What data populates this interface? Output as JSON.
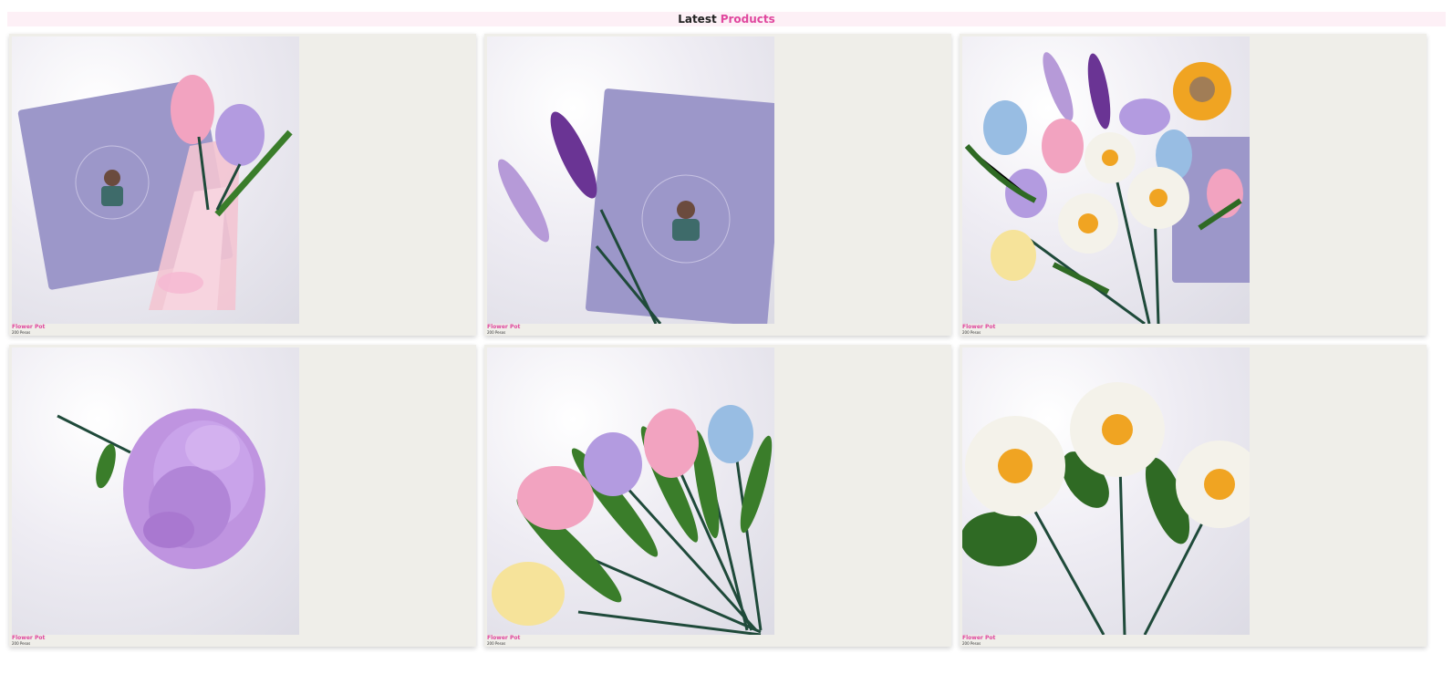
{
  "header": {
    "title_prefix": "Latest",
    "title_accent": "Products"
  },
  "products": [
    {
      "name": "Flower Pot",
      "price": "200 Pesos",
      "photo": "tulip-bouquet-with-book"
    },
    {
      "name": "Flower Pot",
      "price": "200 Pesos",
      "photo": "lavender-stems-with-book"
    },
    {
      "name": "Flower Pot",
      "price": "200 Pesos",
      "photo": "mixed-crochet-flowers"
    },
    {
      "name": "Flower Pot",
      "price": "200 Pesos",
      "photo": "purple-carnation"
    },
    {
      "name": "Flower Pot",
      "price": "200 Pesos",
      "photo": "five-crochet-tulips"
    },
    {
      "name": "Flower Pot",
      "price": "200 Pesos",
      "photo": "three-crochet-daisies"
    }
  ],
  "colors": {
    "accent": "#e0479e",
    "card": "#efeee9",
    "header_bg": "#fdf0f6"
  }
}
